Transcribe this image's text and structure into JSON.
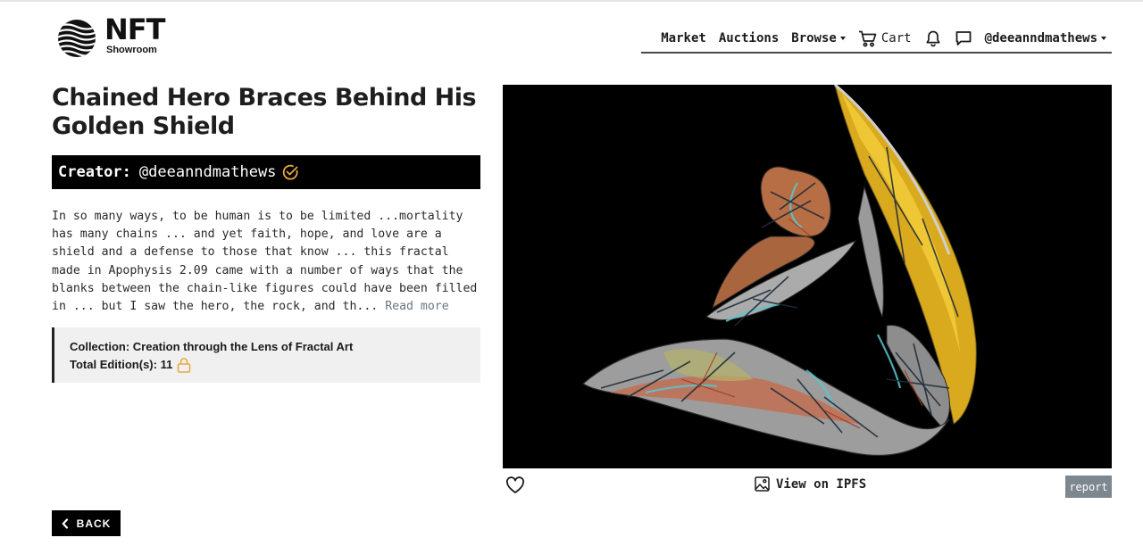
{
  "brand": {
    "name": "NFT",
    "tagline": "Showroom"
  },
  "nav": {
    "market": "Market",
    "auctions": "Auctions",
    "browse": "Browse",
    "cart": "Cart",
    "user": "@deeanndmathews"
  },
  "artwork": {
    "title": "Chained Hero Braces Behind His Golden Shield",
    "creator_label": "Creator:",
    "creator": "@deeanndmathews",
    "description": "In so many ways, to be human is to be limited ...mortality has many chains ... and yet faith, hope, and love are a shield and a defense to those that know ... this fractal made in Apophysis 2.09 came with a number of ways that the blanks between the chain-like figures could have been filled in ... but I saw the hero, the rock, and th...",
    "read_more": "Read more",
    "collection": "Collection: Creation through the Lens of Fractal Art",
    "editions": "Total Edition(s): 11"
  },
  "actions": {
    "view_ipfs": "View on IPFS",
    "report": "report",
    "back": "BACK"
  },
  "icons": {
    "logo": "wave-globe-icon",
    "cart": "cart-icon",
    "notifications": "bell-icon",
    "messages": "chat-icon",
    "verified": "verified-check-icon",
    "lock": "lock-icon",
    "like": "heart-icon",
    "image": "image-icon",
    "back": "chevron-left-icon"
  },
  "colors": {
    "accent_gold": "#e8a83a",
    "report_gray": "#7d8790",
    "panel_gray": "#f0f0f0",
    "read_more": "#6c757d"
  }
}
